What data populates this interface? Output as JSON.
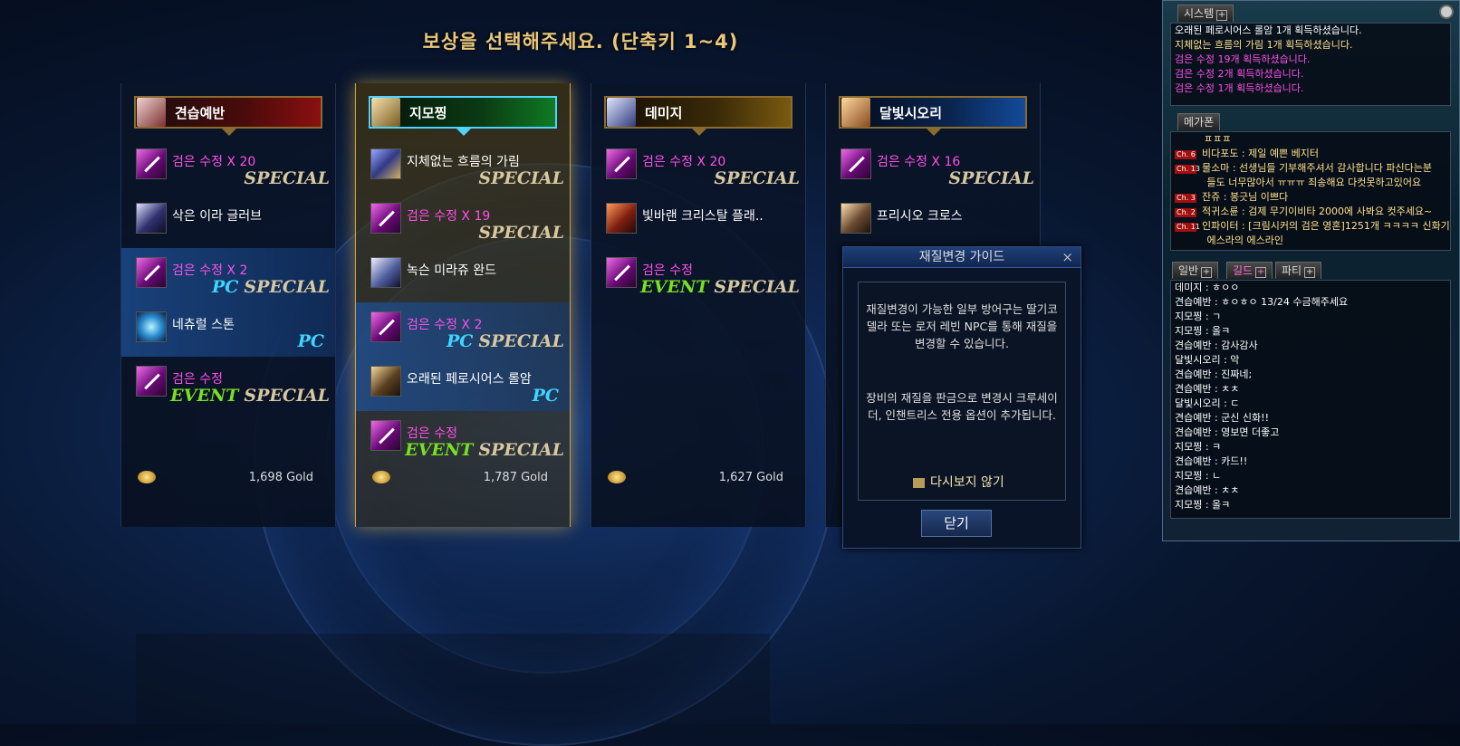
{
  "header": {
    "title": "보상을 선택해주세요. (단축키 1~4)"
  },
  "columns": [
    {
      "name": "견습예반",
      "color": "red",
      "gold": "1,698 Gold",
      "items": [
        {
          "icon": "crystal",
          "name": "검은 수정 X 20",
          "magenta": true,
          "pc": false,
          "tag1": "",
          "tag2": "SPECIAL"
        },
        {
          "icon": "glove",
          "name": "삭은 이라 글러브",
          "magenta": false,
          "pc": false,
          "tag1": "",
          "tag2": ""
        },
        {
          "icon": "crystal",
          "name": "검은 수정 X 2",
          "magenta": true,
          "pc": true,
          "tag1": "PC",
          "tag2": "SPECIAL"
        },
        {
          "icon": "stone",
          "name": "네츄럴 스톤",
          "magenta": false,
          "pc": true,
          "tag1": "PC",
          "tag2": ""
        },
        {
          "icon": "crystal",
          "name": "검은 수정",
          "magenta": true,
          "pc": false,
          "tag1": "EVENT",
          "tag2": "SPECIAL"
        }
      ]
    },
    {
      "name": "지모찡",
      "color": "green",
      "gold": "1,787 Gold",
      "items": [
        {
          "icon": "armor",
          "name": "지체없는 흐름의 가림",
          "magenta": false,
          "pc": false,
          "tag1": "",
          "tag2": "SPECIAL"
        },
        {
          "icon": "crystal",
          "name": "검은 수정 X 19",
          "magenta": true,
          "pc": false,
          "tag1": "",
          "tag2": "SPECIAL"
        },
        {
          "icon": "wand",
          "name": "녹슨 미라쥬 완드",
          "magenta": false,
          "pc": false,
          "tag1": "",
          "tag2": ""
        },
        {
          "icon": "crystal",
          "name": "검은 수정 X 2",
          "magenta": true,
          "pc": true,
          "tag1": "PC",
          "tag2": "SPECIAL"
        },
        {
          "icon": "claw",
          "name": "오래된 페로시어스 롤암",
          "magenta": false,
          "pc": true,
          "tag1": "PC",
          "tag2": ""
        },
        {
          "icon": "crystal",
          "name": "검은 수정",
          "magenta": true,
          "pc": false,
          "tag1": "EVENT",
          "tag2": "SPECIAL"
        }
      ]
    },
    {
      "name": "데미지",
      "color": "gold",
      "gold": "1,627 Gold",
      "items": [
        {
          "icon": "crystal",
          "name": "검은 수정 X 20",
          "magenta": true,
          "pc": false,
          "tag1": "",
          "tag2": "SPECIAL"
        },
        {
          "icon": "blade",
          "name": "빛바랜 크리스탈 플래..",
          "magenta": false,
          "pc": false,
          "tag1": "",
          "tag2": ""
        },
        {
          "icon": "crystal",
          "name": "검은 수정",
          "magenta": true,
          "pc": false,
          "tag1": "EVENT",
          "tag2": "SPECIAL"
        }
      ]
    },
    {
      "name": "달빛시오리",
      "color": "blue",
      "gold": "",
      "items": [
        {
          "icon": "crystal",
          "name": "검은 수정 X 16",
          "magenta": true,
          "pc": false,
          "tag1": "",
          "tag2": "SPECIAL"
        },
        {
          "icon": "cross",
          "name": "프리시오 크로스",
          "magenta": false,
          "pc": false,
          "tag1": "",
          "tag2": ""
        }
      ]
    }
  ],
  "guide": {
    "title": "재질변경 가이드",
    "close": "×",
    "text1": "재질변경이 가능한 일부 방어구는 딸기코 델라 또는 로저 레빈 NPC를 통해 재질을 변경할 수 있습니다.",
    "text2": "장비의 재질을 판금으로 변경시 크루세이더, 인챈트리스 전용 옵션이 추가됩니다.",
    "checkbox": "다시보지 않기",
    "button": "닫기"
  },
  "chat": {
    "system_tab": "시스템",
    "system_log": [
      {
        "text": "오래된 페로시어스 롤암 1개 획득하셨습니다.",
        "color": "white"
      },
      {
        "text": "지체없는 흐름의 가림 1개 획득하셨습니다.",
        "color": "yellow"
      },
      {
        "text": "검은 수정 19개 획득하셨습니다.",
        "color": "magenta"
      },
      {
        "text": "검은 수정 2개 획득하셨습니다.",
        "color": "magenta"
      },
      {
        "text": "검은 수정 1개 획득하셨습니다.",
        "color": "magenta"
      }
    ],
    "megaphone_tab": "메가폰",
    "megaphone_log": [
      {
        "ch": "",
        "text": "ㅍㅍㅍ"
      },
      {
        "ch": "Ch. 6",
        "text": "비다포도 : 제일 예쁜 베지터"
      },
      {
        "ch": "Ch. 13",
        "text": "물소마 : 선생님들 기부해주셔서 감사합니다 파신다는분"
      },
      {
        "ch": "",
        "text": "      들도 너무많아서 ㅠㅠㅠ 죄송해요 다컷못하고있어요"
      },
      {
        "ch": "Ch. 3",
        "text": "잔쥬 : 봉긋님 이쁘다"
      },
      {
        "ch": "Ch. 2",
        "text": "적귀소륜 : 검제 무기이비타 2000에 사봐요 컷주세요~"
      },
      {
        "ch": "Ch. 11",
        "text": "인파이터 : [크림시커의 검은 영혼]1251개 ㅋㅋㅋㅋ 신화기원"
      },
      {
        "ch": "",
        "text": "      에스라의 에스라인"
      }
    ],
    "tabs": [
      "일반",
      "길드",
      "파티"
    ],
    "general_log": [
      "데미지 : ㅎㅇㅇ",
      "견습예반 : ㅎㅇㅎㅇ 13/24 수금해주세요",
      "지모찡 : ㄱ",
      "지모찡 : 올ㅋ",
      "견습예반 : 감사감사",
      "달빛시오리 : 악",
      "견습예반 : 진짜네;",
      "견습예반 : ㅊㅊ",
      "달빛시오리 : ㄷ",
      "견습예반 : 군신 신화!!",
      "견습예반 : 영보면 더좋고",
      "지모찡 : ㅋ",
      "견습예반 : 카드!!",
      "지모찡 : ㄴ",
      "견습예반 : ㅊㅊ",
      "지모찡 : 올ㅋ"
    ]
  }
}
